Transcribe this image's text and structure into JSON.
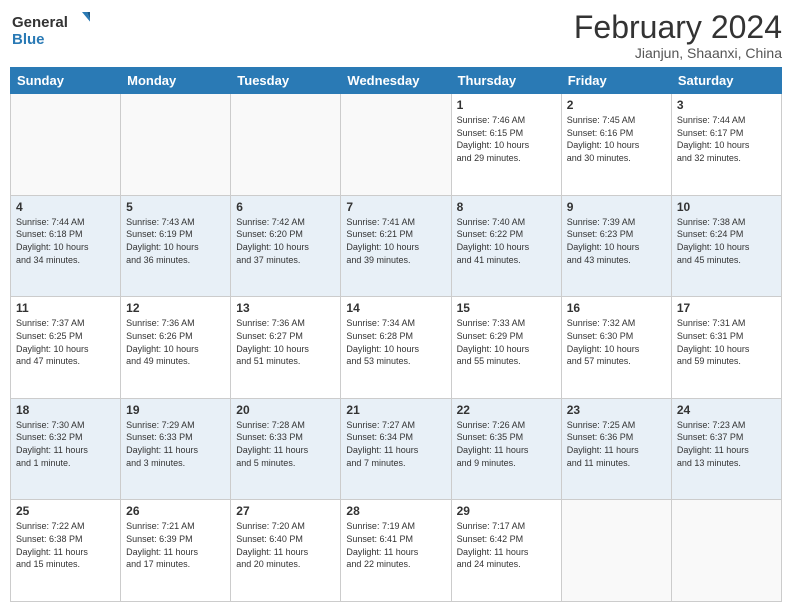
{
  "header": {
    "logo_general": "General",
    "logo_blue": "Blue",
    "month_title": "February 2024",
    "location": "Jianjun, Shaanxi, China"
  },
  "days_of_week": [
    "Sunday",
    "Monday",
    "Tuesday",
    "Wednesday",
    "Thursday",
    "Friday",
    "Saturday"
  ],
  "rows": [
    {
      "alt": false,
      "cells": [
        {
          "num": "",
          "info": ""
        },
        {
          "num": "",
          "info": ""
        },
        {
          "num": "",
          "info": ""
        },
        {
          "num": "",
          "info": ""
        },
        {
          "num": "1",
          "info": "Sunrise: 7:46 AM\nSunset: 6:15 PM\nDaylight: 10 hours\nand 29 minutes."
        },
        {
          "num": "2",
          "info": "Sunrise: 7:45 AM\nSunset: 6:16 PM\nDaylight: 10 hours\nand 30 minutes."
        },
        {
          "num": "3",
          "info": "Sunrise: 7:44 AM\nSunset: 6:17 PM\nDaylight: 10 hours\nand 32 minutes."
        }
      ]
    },
    {
      "alt": true,
      "cells": [
        {
          "num": "4",
          "info": "Sunrise: 7:44 AM\nSunset: 6:18 PM\nDaylight: 10 hours\nand 34 minutes."
        },
        {
          "num": "5",
          "info": "Sunrise: 7:43 AM\nSunset: 6:19 PM\nDaylight: 10 hours\nand 36 minutes."
        },
        {
          "num": "6",
          "info": "Sunrise: 7:42 AM\nSunset: 6:20 PM\nDaylight: 10 hours\nand 37 minutes."
        },
        {
          "num": "7",
          "info": "Sunrise: 7:41 AM\nSunset: 6:21 PM\nDaylight: 10 hours\nand 39 minutes."
        },
        {
          "num": "8",
          "info": "Sunrise: 7:40 AM\nSunset: 6:22 PM\nDaylight: 10 hours\nand 41 minutes."
        },
        {
          "num": "9",
          "info": "Sunrise: 7:39 AM\nSunset: 6:23 PM\nDaylight: 10 hours\nand 43 minutes."
        },
        {
          "num": "10",
          "info": "Sunrise: 7:38 AM\nSunset: 6:24 PM\nDaylight: 10 hours\nand 45 minutes."
        }
      ]
    },
    {
      "alt": false,
      "cells": [
        {
          "num": "11",
          "info": "Sunrise: 7:37 AM\nSunset: 6:25 PM\nDaylight: 10 hours\nand 47 minutes."
        },
        {
          "num": "12",
          "info": "Sunrise: 7:36 AM\nSunset: 6:26 PM\nDaylight: 10 hours\nand 49 minutes."
        },
        {
          "num": "13",
          "info": "Sunrise: 7:36 AM\nSunset: 6:27 PM\nDaylight: 10 hours\nand 51 minutes."
        },
        {
          "num": "14",
          "info": "Sunrise: 7:34 AM\nSunset: 6:28 PM\nDaylight: 10 hours\nand 53 minutes."
        },
        {
          "num": "15",
          "info": "Sunrise: 7:33 AM\nSunset: 6:29 PM\nDaylight: 10 hours\nand 55 minutes."
        },
        {
          "num": "16",
          "info": "Sunrise: 7:32 AM\nSunset: 6:30 PM\nDaylight: 10 hours\nand 57 minutes."
        },
        {
          "num": "17",
          "info": "Sunrise: 7:31 AM\nSunset: 6:31 PM\nDaylight: 10 hours\nand 59 minutes."
        }
      ]
    },
    {
      "alt": true,
      "cells": [
        {
          "num": "18",
          "info": "Sunrise: 7:30 AM\nSunset: 6:32 PM\nDaylight: 11 hours\nand 1 minute."
        },
        {
          "num": "19",
          "info": "Sunrise: 7:29 AM\nSunset: 6:33 PM\nDaylight: 11 hours\nand 3 minutes."
        },
        {
          "num": "20",
          "info": "Sunrise: 7:28 AM\nSunset: 6:33 PM\nDaylight: 11 hours\nand 5 minutes."
        },
        {
          "num": "21",
          "info": "Sunrise: 7:27 AM\nSunset: 6:34 PM\nDaylight: 11 hours\nand 7 minutes."
        },
        {
          "num": "22",
          "info": "Sunrise: 7:26 AM\nSunset: 6:35 PM\nDaylight: 11 hours\nand 9 minutes."
        },
        {
          "num": "23",
          "info": "Sunrise: 7:25 AM\nSunset: 6:36 PM\nDaylight: 11 hours\nand 11 minutes."
        },
        {
          "num": "24",
          "info": "Sunrise: 7:23 AM\nSunset: 6:37 PM\nDaylight: 11 hours\nand 13 minutes."
        }
      ]
    },
    {
      "alt": false,
      "cells": [
        {
          "num": "25",
          "info": "Sunrise: 7:22 AM\nSunset: 6:38 PM\nDaylight: 11 hours\nand 15 minutes."
        },
        {
          "num": "26",
          "info": "Sunrise: 7:21 AM\nSunset: 6:39 PM\nDaylight: 11 hours\nand 17 minutes."
        },
        {
          "num": "27",
          "info": "Sunrise: 7:20 AM\nSunset: 6:40 PM\nDaylight: 11 hours\nand 20 minutes."
        },
        {
          "num": "28",
          "info": "Sunrise: 7:19 AM\nSunset: 6:41 PM\nDaylight: 11 hours\nand 22 minutes."
        },
        {
          "num": "29",
          "info": "Sunrise: 7:17 AM\nSunset: 6:42 PM\nDaylight: 11 hours\nand 24 minutes."
        },
        {
          "num": "",
          "info": ""
        },
        {
          "num": "",
          "info": ""
        }
      ]
    }
  ]
}
